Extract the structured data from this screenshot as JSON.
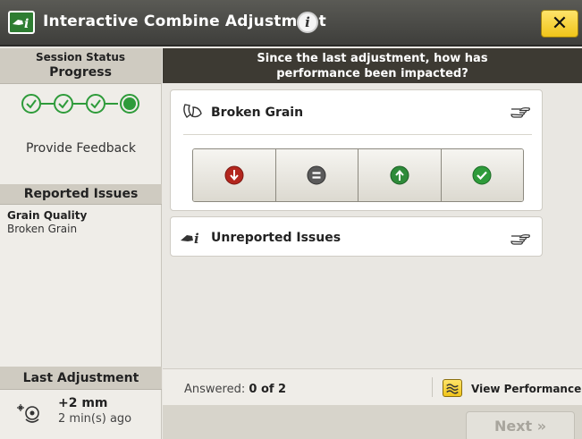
{
  "window": {
    "title": "Interactive Combine Adjustment",
    "logo_text": "i",
    "close_label": "✕",
    "info_label": "i"
  },
  "sidebar": {
    "session_status": "Session Status",
    "progress_title": "Progress",
    "progress_steps_total": 4,
    "progress_steps_completed": 3,
    "progress_current_step": 4,
    "provide_feedback": "Provide Feedback",
    "reported_issues_title": "Reported Issues",
    "reported_issues": [
      {
        "category": "Grain Quality",
        "name": "Broken Grain"
      }
    ],
    "last_adjustment_title": "Last Adjustment",
    "last_adjustment_value": "+2 mm",
    "last_adjustment_time": "2 min(s) ago"
  },
  "main": {
    "question": "Since the last adjustment, how has performance been impacted?",
    "question_line1": "Since the last adjustment, how has",
    "question_line2": "performance been impacted?",
    "issues": [
      {
        "title": "Broken Grain",
        "icon": "broken-grain-icon",
        "ratings": [
          {
            "name": "worse",
            "icon": "down-arrow-icon",
            "color": "#b3261e"
          },
          {
            "name": "no-change",
            "icon": "equals-icon",
            "color": "#5a5a5a"
          },
          {
            "name": "better",
            "icon": "up-arrow-icon",
            "color": "#2e8b3a"
          },
          {
            "name": "resolved",
            "icon": "check-icon",
            "color": "#2e9b3a"
          }
        ]
      },
      {
        "title": "Unreported Issues",
        "icon": "john-deere-info-icon"
      }
    ]
  },
  "footer": {
    "answered_label": "Answered:",
    "answered_value": "0 of 2",
    "view_performance": "View Performance",
    "next_label": "Next »"
  },
  "colors": {
    "accent_green": "#2e9b3a",
    "banner_dark": "#3d3a33",
    "close_yellow": "#f0c419"
  }
}
